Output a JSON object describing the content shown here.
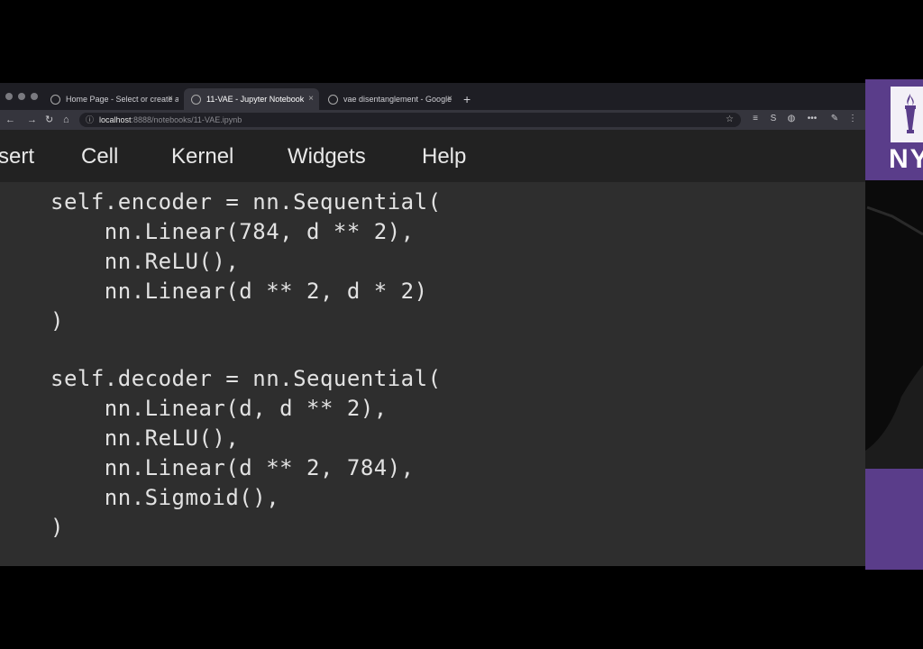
{
  "browser": {
    "tabs": [
      {
        "label": "Home Page - Select or create a",
        "active": false
      },
      {
        "label": "11-VAE - Jupyter Notebook",
        "active": true
      },
      {
        "label": "vae disentanglement - Google",
        "active": false
      }
    ],
    "new_tab_symbol": "+",
    "url_host": "localhost",
    "url_rest": ":8888/notebooks/11-VAE.ipynb",
    "nav": {
      "back": "←",
      "forward": "→",
      "reload": "↻",
      "home": "⌂"
    },
    "star": "☆",
    "extensions": [
      "≡",
      "S",
      "◍",
      "•••",
      "✎",
      "⋮"
    ]
  },
  "menu": [
    "sert",
    "Cell",
    "Kernel",
    "Widgets",
    "Help"
  ],
  "code_lines": [
    "self.encoder = nn.Sequential(",
    "    nn.Linear(784, d ** 2),",
    "    nn.ReLU(),",
    "    nn.Linear(d ** 2, d * 2)",
    ")",
    "",
    "self.decoder = nn.Sequential(",
    "    nn.Linear(d, d ** 2),",
    "    nn.ReLU(),",
    "    nn.Linear(d ** 2, 784),",
    "    nn.Sigmoid(),",
    ")"
  ],
  "logo_text": "NY",
  "colors": {
    "brand_purple": "#5a3d8a",
    "editor_bg": "#2e2e2e"
  }
}
